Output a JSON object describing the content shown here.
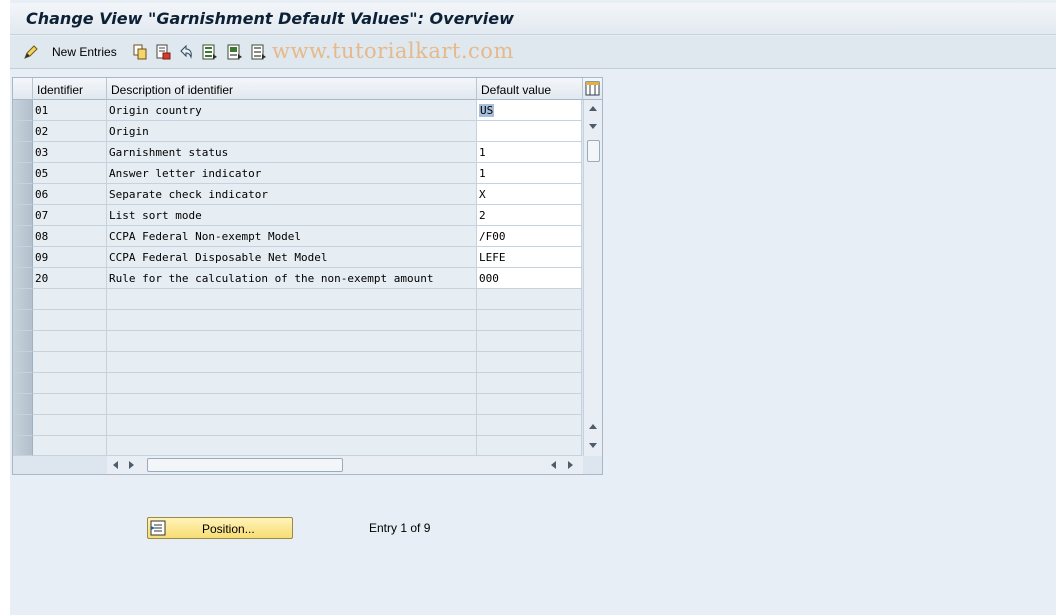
{
  "title": "Change View \"Garnishment Default Values\": Overview",
  "watermark": "www.tutorialkart.com",
  "toolbar": {
    "new_entries_label": "New Entries",
    "icons": [
      "change-display-icon",
      "copy-icon",
      "delete-icon",
      "undo-icon",
      "select-all-icon",
      "select-block-icon",
      "deselect-all-icon"
    ]
  },
  "table": {
    "headers": {
      "id": "Identifier",
      "desc": "Description of identifier",
      "value": "Default value"
    },
    "rows": [
      {
        "id": "01",
        "desc": "Origin country",
        "value": "US"
      },
      {
        "id": "02",
        "desc": "Origin",
        "value": ""
      },
      {
        "id": "03",
        "desc": "Garnishment status",
        "value": "1"
      },
      {
        "id": "05",
        "desc": "Answer letter indicator",
        "value": "1"
      },
      {
        "id": "06",
        "desc": "Separate check indicator",
        "value": "X"
      },
      {
        "id": "07",
        "desc": "List sort mode",
        "value": "2"
      },
      {
        "id": "08",
        "desc": "CCPA Federal Non-exempt Model",
        "value": "/F00"
      },
      {
        "id": "09",
        "desc": "CCPA Federal Disposable Net Model",
        "value": "LEFE"
      },
      {
        "id": "20",
        "desc": "Rule for the calculation of the non-exempt amount",
        "value": "000"
      }
    ]
  },
  "footer": {
    "position_label": "Position...",
    "entry_info": "Entry 1 of 9"
  }
}
